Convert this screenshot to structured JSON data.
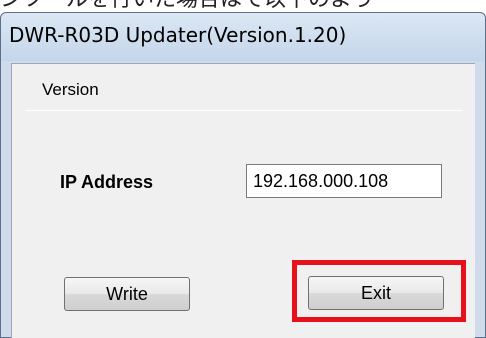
{
  "document": {
    "caption": "ンツールを行いた場合はて以下のよう"
  },
  "window": {
    "title": "DWR-R03D Updater(Version.1.20)"
  },
  "tab": {
    "label": "Version"
  },
  "form": {
    "ip_label": "IP Address",
    "ip_value": "192.168.000.108"
  },
  "buttons": {
    "write_label": "Write",
    "exit_label": "Exit"
  },
  "annotation": {
    "highlight_color": "#e8101a",
    "highlighted_target": "exit-button"
  }
}
